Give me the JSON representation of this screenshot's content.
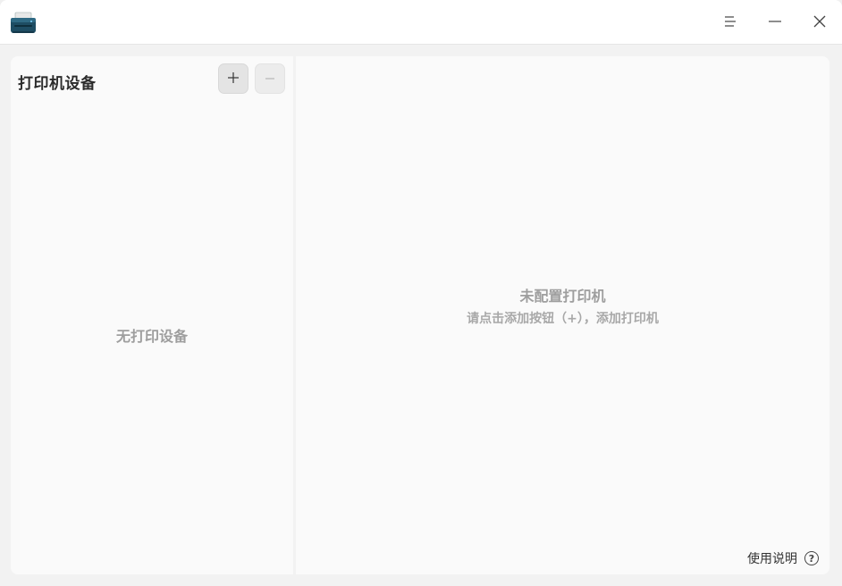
{
  "titlebar": {
    "icon": "printer-icon",
    "menu_icon": "menu-icon",
    "minimize_icon": "minimize-icon",
    "close_icon": "close-icon"
  },
  "left_panel": {
    "title": "打印机设备",
    "add_icon": "plus-icon",
    "remove_icon": "minus-icon",
    "empty_text": "无打印设备"
  },
  "right_panel": {
    "empty_title": "未配置打印机",
    "empty_hint": "请点击添加按钮（+），添加打印机",
    "help_label": "使用说明",
    "help_icon": "question-icon"
  },
  "colors": {
    "accent": "#1a4f66",
    "window_bg": "#f2f2f2",
    "panel_bg": "#fafafa",
    "muted_text": "#9e9e9e"
  }
}
